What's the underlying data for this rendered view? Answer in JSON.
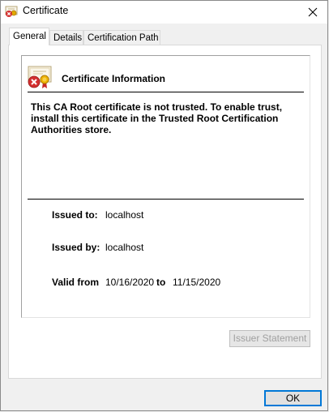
{
  "window": {
    "title": "Certificate",
    "icon": "certificate-error-icon"
  },
  "tabs": [
    {
      "label": "General",
      "active": true
    },
    {
      "label": "Details",
      "active": false
    },
    {
      "label": "Certification Path",
      "active": false
    }
  ],
  "info": {
    "header": "Certificate Information",
    "warning": "This CA Root certificate is not trusted. To enable trust, install this certificate in the Trusted Root Certification Authorities store."
  },
  "fields": {
    "issued_to_label": "Issued to:",
    "issued_to_value": "localhost",
    "issued_by_label": "Issued by:",
    "issued_by_value": "localhost",
    "valid_from_label": "Valid from",
    "valid_from_value": "10/16/2020",
    "valid_to_label": "to",
    "valid_to_value": "11/15/2020"
  },
  "buttons": {
    "issuer_statement": "Issuer Statement",
    "ok": "OK"
  },
  "colors": {
    "accent": "#0078d7",
    "error_red": "#d32f2f",
    "seal_gold": "#e0a800"
  }
}
